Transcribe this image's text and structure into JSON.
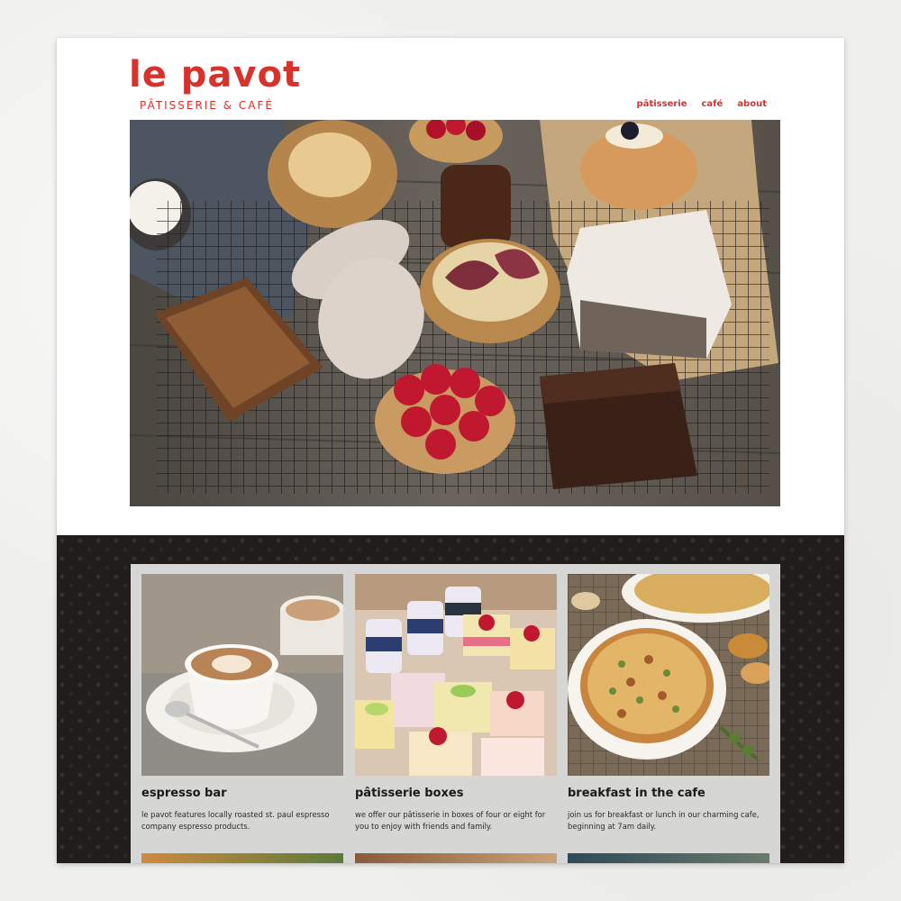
{
  "brand": {
    "name": "le pavot",
    "tagline": "PÂTISSERIE & CAFÉ",
    "color": "#d8322c"
  },
  "nav": {
    "items": [
      {
        "label": "pâtisserie"
      },
      {
        "label": "café"
      },
      {
        "label": "about"
      }
    ]
  },
  "hero": {
    "image": "pastries-on-cooling-rack"
  },
  "cards": [
    {
      "image": "latte-art-cups",
      "title": "espresso bar",
      "desc": "le pavot features locally roasted st. paul espresso company espresso products."
    },
    {
      "image": "petit-four-box",
      "title": "pâtisserie boxes",
      "desc": "we offer our pâtisserie in boxes of four or eight for you to enjoy with friends and family."
    },
    {
      "image": "quiche-dish",
      "title": "breakfast in the cafe",
      "desc": "join us for breakfast or lunch in our charming cafe, beginning at 7am daily."
    }
  ]
}
